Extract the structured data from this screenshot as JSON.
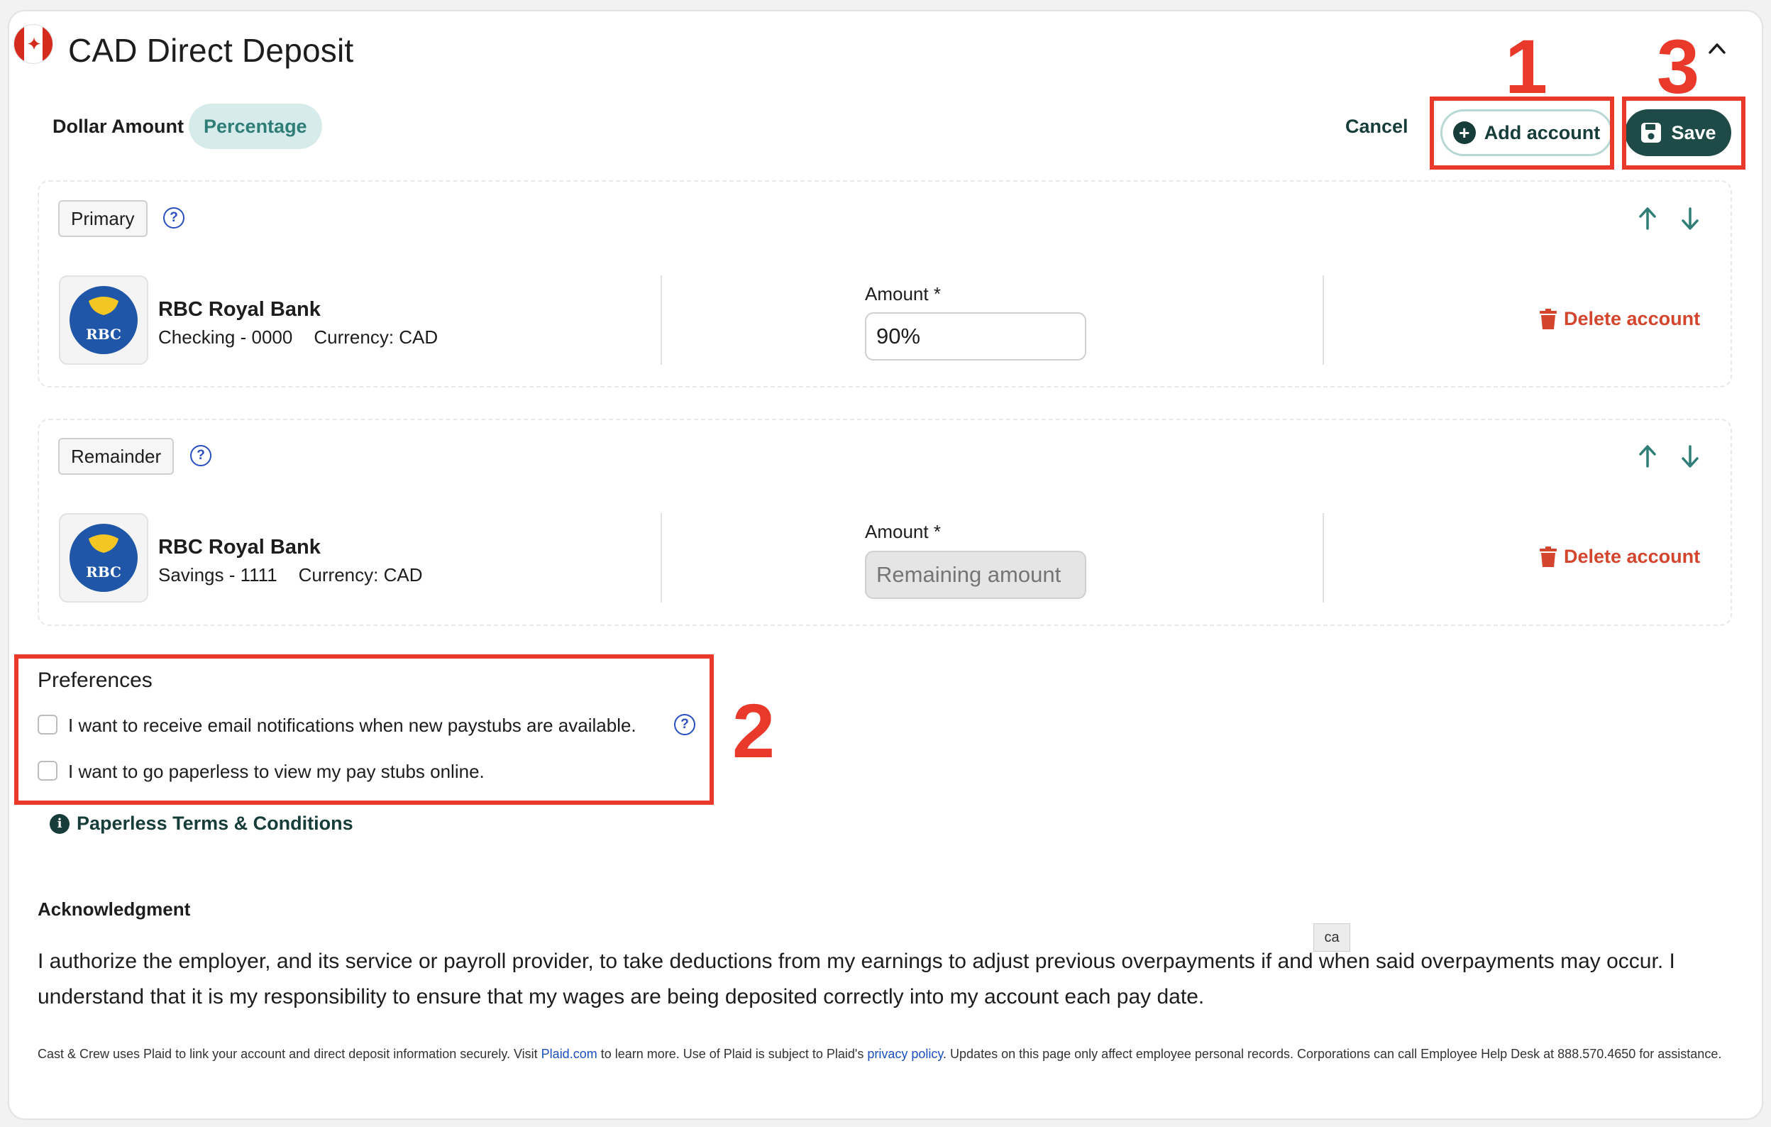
{
  "header": {
    "title": "CAD Direct Deposit",
    "flag_icon": "canada-flag-icon",
    "collapse_icon": "chevron-up-icon"
  },
  "tabs": [
    {
      "label": "Dollar Amount",
      "active": false
    },
    {
      "label": "Percentage",
      "active": true
    }
  ],
  "actions": {
    "cancel_label": "Cancel",
    "add_account_label": "Add account",
    "save_label": "Save"
  },
  "annotations": {
    "n1": "1",
    "n2": "2",
    "n3": "3"
  },
  "accounts": [
    {
      "role": "Primary",
      "bank_name": "RBC Royal Bank",
      "bank_logo_text": "RBC",
      "account": "Checking - 0000",
      "currency": "Currency: CAD",
      "amount_label": "Amount *",
      "amount_value": "90%",
      "amount_placeholder": "",
      "delete_label": "Delete account"
    },
    {
      "role": "Remainder",
      "bank_name": "RBC Royal Bank",
      "bank_logo_text": "RBC",
      "account": "Savings - 1111",
      "currency": "Currency: CAD",
      "amount_label": "Amount *",
      "amount_value": "",
      "amount_placeholder": "Remaining amount",
      "delete_label": "Delete account"
    }
  ],
  "preferences": {
    "title": "Preferences",
    "email_label": "I want to receive email notifications when new paystubs are available.",
    "paperless_label": "I want to go paperless to view my pay stubs online.",
    "terms_label": "Paperless Terms & Conditions"
  },
  "acknowledgment": {
    "title": "Acknowledgment",
    "text": "I authorize the employer, and its service or payroll provider, to take deductions from my earnings to adjust previous overpayments if and when said overpayments may occur. I understand that it is my responsibility to ensure that my wages are being deposited correctly into my account each pay date.",
    "tooltip": "ca"
  },
  "footer": {
    "part1": "Cast & Crew uses Plaid to link your account and direct deposit information securely. Visit ",
    "link1": "Plaid.com",
    "part2": " to learn more. Use of Plaid is subject to Plaid's ",
    "link2": "privacy policy",
    "part3": ". Updates on this page only affect employee personal records. Corporations can call Employee Help Desk at 888.570.4650 for assistance."
  },
  "colors": {
    "accent_dark": "#1e4a47",
    "accent_light": "#d7ecea",
    "danger": "#d4452e",
    "annotation": "#e8392a",
    "link": "#1a4fc0"
  }
}
